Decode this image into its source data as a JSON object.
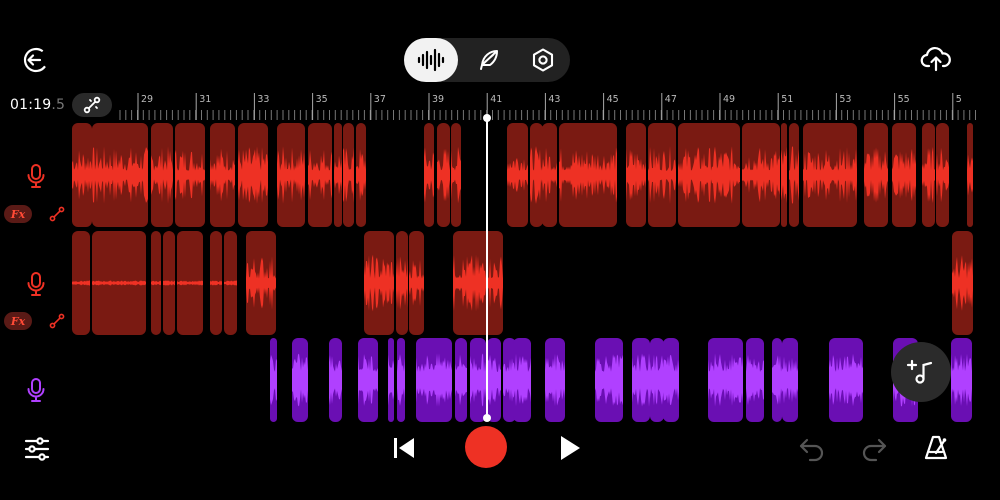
{
  "header": {
    "time_main": "01:19",
    "time_frac": ".5",
    "mode_tabs": [
      {
        "icon": "waveform-icon",
        "active": true
      },
      {
        "icon": "feather-icon",
        "active": false
      },
      {
        "icon": "hexagon-settings-icon",
        "active": false
      }
    ]
  },
  "ruler": {
    "labels": [
      "29",
      "31",
      "33",
      "35",
      "37",
      "39",
      "41",
      "43",
      "45",
      "47",
      "49",
      "51",
      "53",
      "55",
      "5"
    ]
  },
  "tracks": [
    {
      "color": "#ee3124",
      "clip_color": "#7a1a12",
      "icons": [
        "microphone-icon",
        "fx-badge",
        "link-icon"
      ],
      "fx_label": "Fx"
    },
    {
      "color": "#ee3124",
      "clip_color": "#7a1a12",
      "icons": [
        "microphone-icon",
        "fx-badge",
        "link-icon"
      ],
      "fx_label": "Fx"
    },
    {
      "color": "#b040ff",
      "clip_color": "#6a0fb3",
      "icons": [
        "microphone-icon"
      ]
    }
  ],
  "colors": {
    "accent_red": "#ee3124",
    "accent_purple": "#b040ff",
    "background": "#000000"
  }
}
